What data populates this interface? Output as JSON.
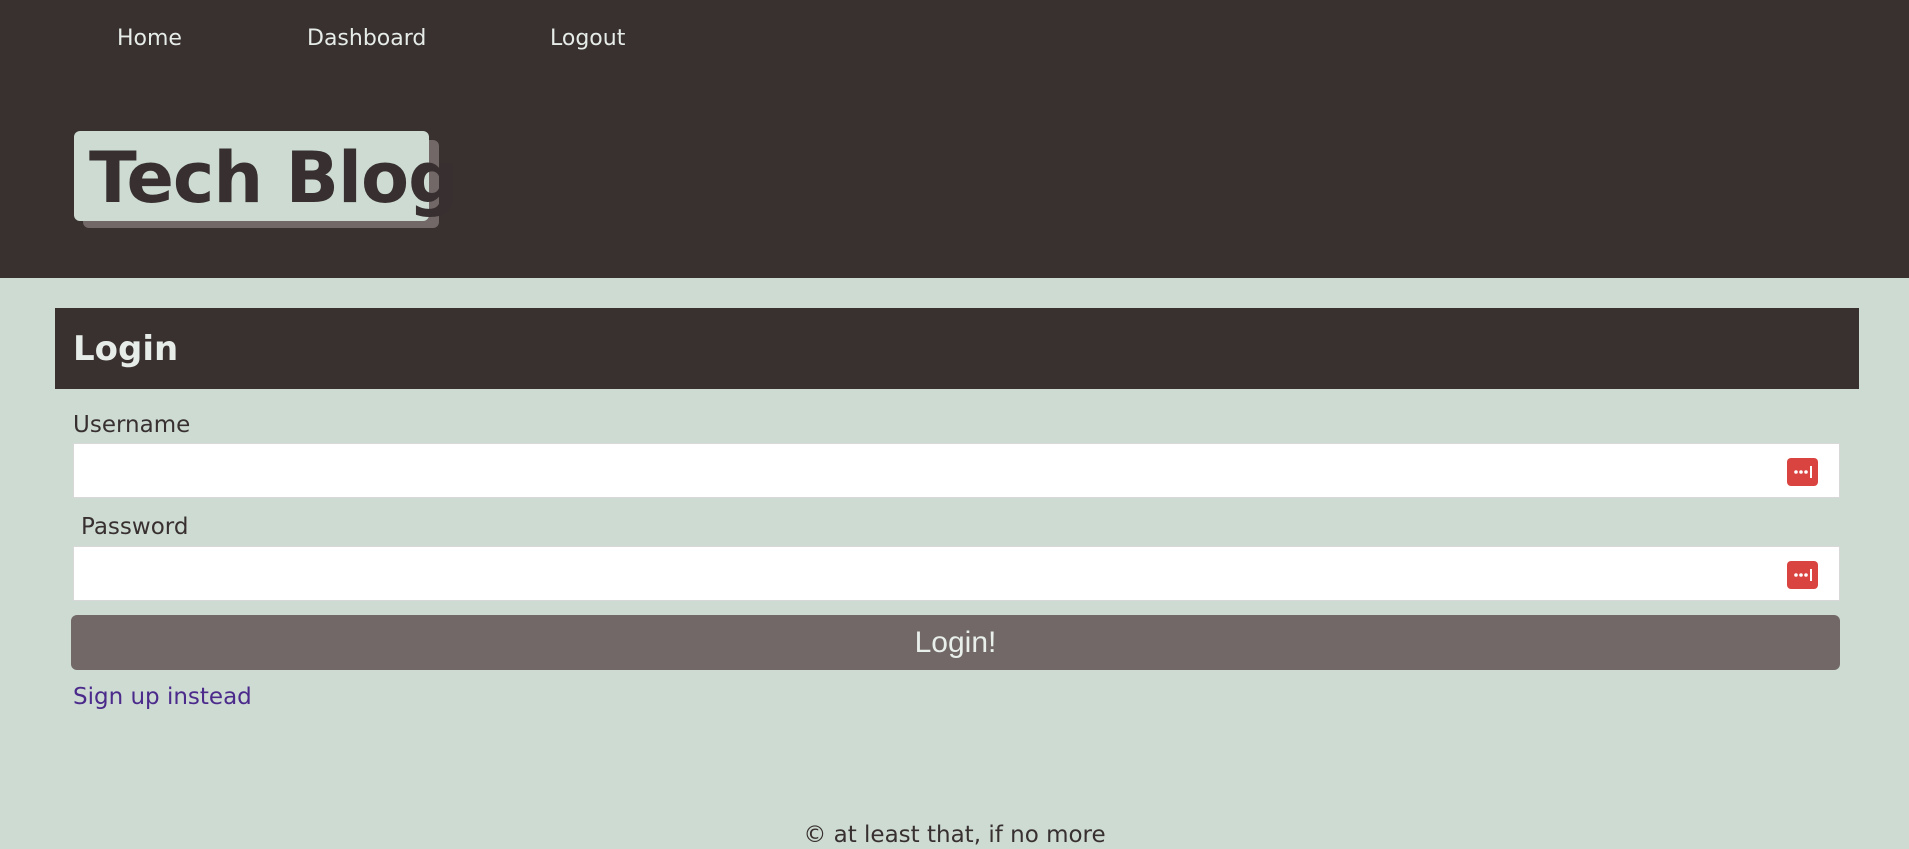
{
  "nav": {
    "home": "Home",
    "dashboard": "Dashboard",
    "logout": "Logout"
  },
  "brand": {
    "title": "Tech Blog"
  },
  "login": {
    "heading": "Login",
    "username_label": "Username",
    "password_label": "Password",
    "username_value": "",
    "password_value": "",
    "submit_label": "Login!",
    "signup_link": "Sign up instead",
    "password_manager_icon": "password-manager-icon"
  },
  "footer": {
    "text": "© at least that, if no more"
  },
  "colors": {
    "header_bg": "#393030",
    "page_bg": "#cddbd3",
    "button_bg": "#716867",
    "link": "#4b2a8b",
    "icon_red": "#d94441"
  }
}
